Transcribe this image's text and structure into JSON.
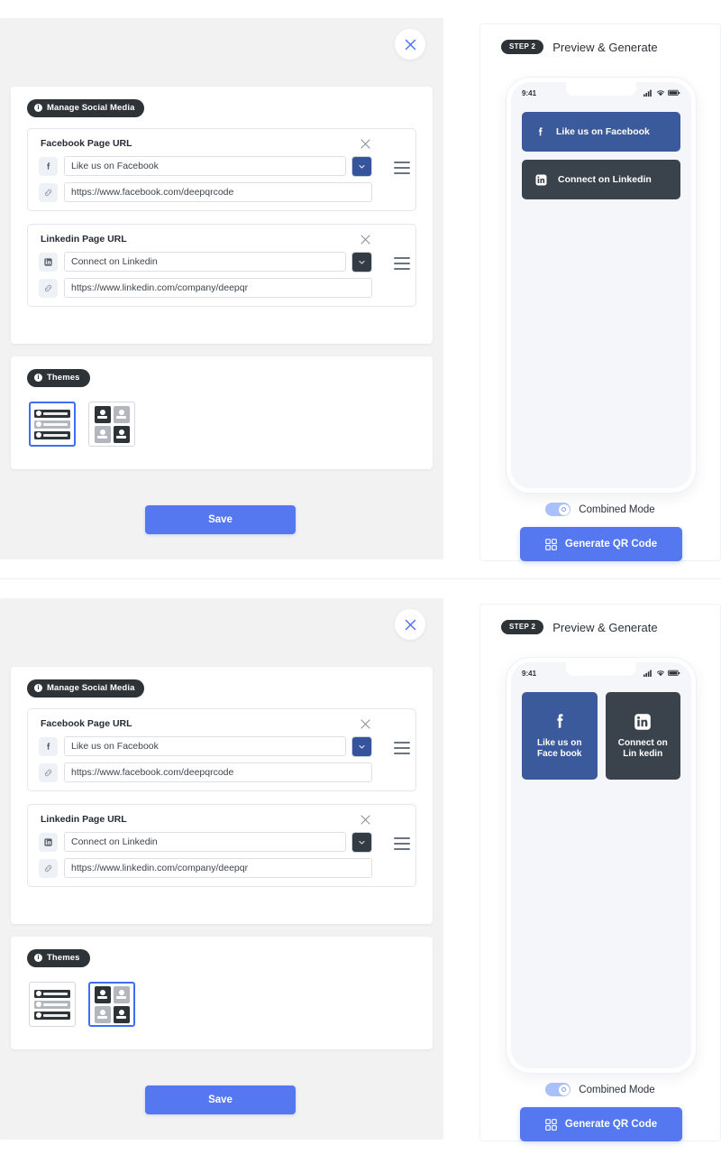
{
  "theme_colors": {
    "accent_blue": "#5578f0",
    "facebook_blue": "#3a5a9b",
    "linkedin_dark": "#3a424c",
    "pill_dark": "#2e3338",
    "modal_bg": "#f2f2f3",
    "selection_border": "#3f6ef2"
  },
  "variants": [
    {
      "id": "list-theme",
      "modal": {
        "close_icon": "close-icon",
        "sections": [
          {
            "pill": {
              "label": "Manage Social Media",
              "icon": "info-icon"
            },
            "entries": [
              {
                "title": "Facebook Page URL",
                "platform_icon": "facebook-icon",
                "link_icon": "link-icon",
                "title_value": "Like us on Facebook",
                "url_value": "https://www.facebook.com/deepqrcode",
                "dropdown_icon": "chevron-down-icon",
                "remove_icon": "close-icon",
                "drag_icon": "drag-handle-icon"
              },
              {
                "title": "Linkedin Page URL",
                "platform_icon": "linkedin-icon",
                "link_icon": "link-icon",
                "title_value": "Connect on Linkedin",
                "url_value": "https://www.linkedin.com/company/deepqr",
                "dropdown_icon": "chevron-down-icon",
                "remove_icon": "close-icon",
                "drag_icon": "drag-handle-icon"
              }
            ]
          },
          {
            "pill": {
              "label": "Themes",
              "icon": "info-icon"
            },
            "themes": [
              {
                "name": "list-theme",
                "selected": true
              },
              {
                "name": "grid-theme",
                "selected": false
              }
            ]
          }
        ],
        "save_label": "Save"
      },
      "preview": {
        "step_label": "STEP 2",
        "title": "Preview & Generate",
        "phone": {
          "time": "9:41",
          "signal_icon": "cellular-signal-icon",
          "wifi_icon": "wifi-icon",
          "battery_icon": "battery-icon",
          "layout": "list",
          "buttons": [
            {
              "label": "Like us on Facebook",
              "icon": "facebook-icon",
              "color": "#3a5a9b"
            },
            {
              "label": "Connect on Linkedin",
              "icon": "linkedin-icon",
              "color": "#3a424c"
            }
          ]
        },
        "combined_mode_label": "Combined Mode",
        "combined_mode_on": true,
        "generate_label": "Generate QR Code",
        "generate_icon": "qr-code-icon"
      }
    },
    {
      "id": "grid-theme",
      "modal": {
        "close_icon": "close-icon",
        "sections": [
          {
            "pill": {
              "label": "Manage Social Media",
              "icon": "info-icon"
            },
            "entries": [
              {
                "title": "Facebook Page URL",
                "platform_icon": "facebook-icon",
                "link_icon": "link-icon",
                "title_value": "Like us on Facebook",
                "url_value": "https://www.facebook.com/deepqrcode",
                "dropdown_icon": "chevron-down-icon",
                "remove_icon": "close-icon",
                "drag_icon": "drag-handle-icon"
              },
              {
                "title": "Linkedin Page URL",
                "platform_icon": "linkedin-icon",
                "link_icon": "link-icon",
                "title_value": "Connect on Linkedin",
                "url_value": "https://www.linkedin.com/company/deepqr",
                "dropdown_icon": "chevron-down-icon",
                "remove_icon": "close-icon",
                "drag_icon": "drag-handle-icon"
              }
            ]
          },
          {
            "pill": {
              "label": "Themes",
              "icon": "info-icon"
            },
            "themes": [
              {
                "name": "list-theme",
                "selected": false
              },
              {
                "name": "grid-theme",
                "selected": true
              }
            ]
          }
        ],
        "save_label": "Save"
      },
      "preview": {
        "step_label": "STEP 2",
        "title": "Preview & Generate",
        "phone": {
          "time": "9:41",
          "signal_icon": "cellular-signal-icon",
          "wifi_icon": "wifi-icon",
          "battery_icon": "battery-icon",
          "layout": "grid",
          "buttons": [
            {
              "label": "Like us on Face book",
              "icon": "facebook-icon",
              "color": "#3a5a9b"
            },
            {
              "label": "Connect on Lin kedin",
              "icon": "linkedin-icon",
              "color": "#3a424c"
            }
          ]
        },
        "combined_mode_label": "Combined Mode",
        "combined_mode_on": true,
        "generate_label": "Generate QR Code",
        "generate_icon": "qr-code-icon"
      }
    }
  ]
}
